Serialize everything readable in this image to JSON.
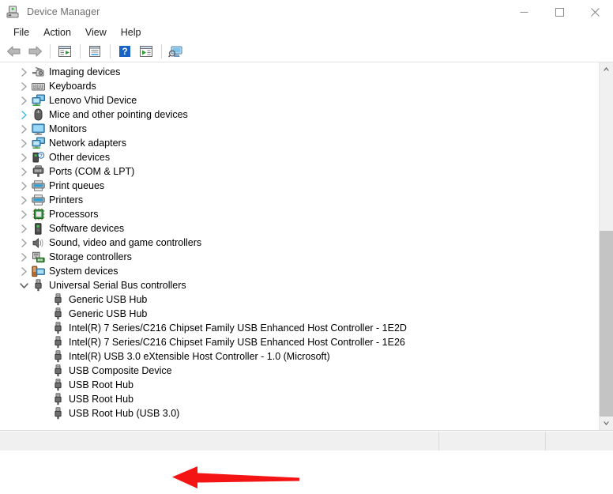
{
  "window": {
    "title": "Device Manager",
    "icon": "device-manager-icon",
    "controls": {
      "minimize": "minimize-icon",
      "maximize": "maximize-icon",
      "close": "close-icon"
    }
  },
  "menubar": {
    "items": [
      {
        "label": "File"
      },
      {
        "label": "Action"
      },
      {
        "label": "View"
      },
      {
        "label": "Help"
      }
    ]
  },
  "toolbar": {
    "buttons": [
      {
        "name": "back-button",
        "icon": "back-arrow-icon"
      },
      {
        "name": "forward-button",
        "icon": "forward-arrow-icon"
      },
      {
        "name": "separator-1",
        "icon": "separator"
      },
      {
        "name": "show-hide-console-tree-button",
        "icon": "console-tree-icon"
      },
      {
        "name": "separator-2",
        "icon": "separator"
      },
      {
        "name": "properties-button",
        "icon": "properties-icon"
      },
      {
        "name": "separator-3",
        "icon": "separator"
      },
      {
        "name": "help-button",
        "icon": "help-question-icon"
      },
      {
        "name": "update-driver-button",
        "icon": "update-driver-icon"
      },
      {
        "name": "separator-4",
        "icon": "separator"
      },
      {
        "name": "scan-hardware-changes-button",
        "icon": "scan-monitor-icon"
      }
    ]
  },
  "tree": {
    "nodes": [
      {
        "label": "Imaging devices",
        "level": "category",
        "state": "collapsed",
        "icon": "camera-icon",
        "hover": false
      },
      {
        "label": "Keyboards",
        "level": "category",
        "state": "collapsed",
        "icon": "keyboard-icon",
        "hover": false
      },
      {
        "label": "Lenovo Vhid Device",
        "level": "category",
        "state": "collapsed",
        "icon": "network-display-icon",
        "hover": false
      },
      {
        "label": "Mice and other pointing devices",
        "level": "category",
        "state": "collapsed",
        "icon": "mouse-icon",
        "hover": true
      },
      {
        "label": "Monitors",
        "level": "category",
        "state": "collapsed",
        "icon": "monitor-icon",
        "hover": false
      },
      {
        "label": "Network adapters",
        "level": "category",
        "state": "collapsed",
        "icon": "network-display-icon",
        "hover": false
      },
      {
        "label": "Other devices",
        "level": "category",
        "state": "collapsed",
        "icon": "unknown-device-icon",
        "hover": false
      },
      {
        "label": "Ports (COM & LPT)",
        "level": "category",
        "state": "collapsed",
        "icon": "port-icon",
        "hover": false
      },
      {
        "label": "Print queues",
        "level": "category",
        "state": "collapsed",
        "icon": "printer-icon",
        "hover": false
      },
      {
        "label": "Printers",
        "level": "category",
        "state": "collapsed",
        "icon": "printer-icon",
        "hover": false
      },
      {
        "label": "Processors",
        "level": "category",
        "state": "collapsed",
        "icon": "processor-icon",
        "hover": false
      },
      {
        "label": "Software devices",
        "level": "category",
        "state": "collapsed",
        "icon": "software-device-icon",
        "hover": false
      },
      {
        "label": "Sound, video and game controllers",
        "level": "category",
        "state": "collapsed",
        "icon": "speaker-icon",
        "hover": false
      },
      {
        "label": "Storage controllers",
        "level": "category",
        "state": "collapsed",
        "icon": "storage-controller-icon",
        "hover": false
      },
      {
        "label": "System devices",
        "level": "category",
        "state": "collapsed",
        "icon": "system-device-icon",
        "hover": false
      },
      {
        "label": "Universal Serial Bus controllers",
        "level": "category",
        "state": "expanded",
        "icon": "usb-icon",
        "hover": false
      },
      {
        "label": "Generic USB Hub",
        "level": "child",
        "state": "leaf",
        "icon": "usb-icon",
        "hover": false
      },
      {
        "label": "Generic USB Hub",
        "level": "child",
        "state": "leaf",
        "icon": "usb-icon",
        "hover": false
      },
      {
        "label": "Intel(R) 7 Series/C216 Chipset Family USB Enhanced Host Controller - 1E2D",
        "level": "child",
        "state": "leaf",
        "icon": "usb-icon",
        "hover": false
      },
      {
        "label": "Intel(R) 7 Series/C216 Chipset Family USB Enhanced Host Controller - 1E26",
        "level": "child",
        "state": "leaf",
        "icon": "usb-icon",
        "hover": false
      },
      {
        "label": "Intel(R) USB 3.0 eXtensible Host Controller - 1.0 (Microsoft)",
        "level": "child",
        "state": "leaf",
        "icon": "usb-icon",
        "hover": false
      },
      {
        "label": "USB Composite Device",
        "level": "child",
        "state": "leaf",
        "icon": "usb-icon",
        "hover": false
      },
      {
        "label": "USB Root Hub",
        "level": "child",
        "state": "leaf",
        "icon": "usb-icon",
        "hover": false
      },
      {
        "label": "USB Root Hub",
        "level": "child",
        "state": "leaf",
        "icon": "usb-icon",
        "hover": false
      },
      {
        "label": "USB Root Hub (USB 3.0)",
        "level": "child",
        "state": "leaf",
        "icon": "usb-icon",
        "hover": false
      }
    ]
  },
  "annotation": {
    "name": "red-arrow-annotation",
    "color": "#f51414",
    "points_to": "USB Root Hub (USB 3.0)"
  },
  "scrollbar": {
    "up_arrow": "scroll-up-icon",
    "down_arrow": "scroll-down-icon",
    "thumb_top_percent": 45.5
  },
  "statusbar": {
    "cells": [
      "",
      "",
      ""
    ]
  },
  "colors": {
    "accent_hover_chevron": "#3bbdf0",
    "chevron": "#a0a0a0",
    "title_text": "#6e6e6e",
    "annotation_red": "#f51414"
  }
}
